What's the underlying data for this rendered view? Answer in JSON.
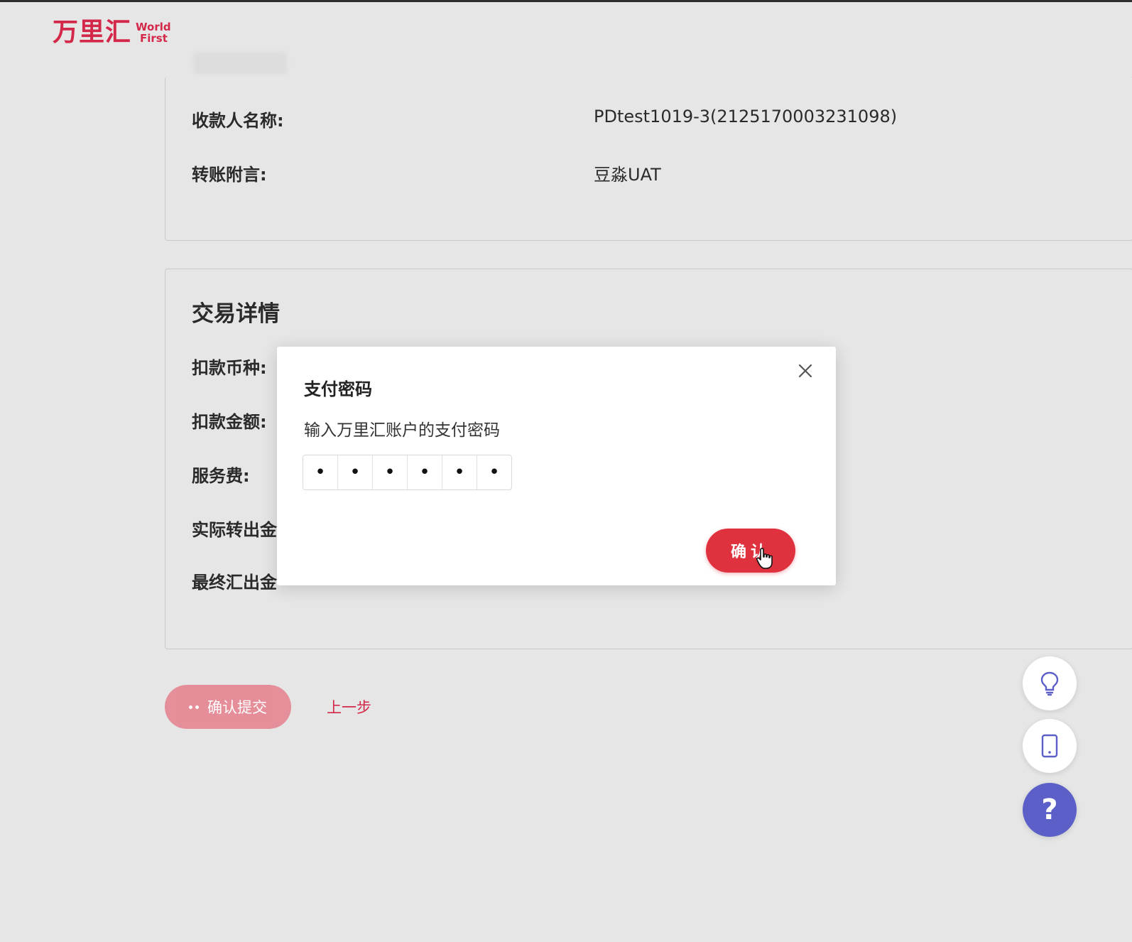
{
  "brand": {
    "name_cn": "万里汇",
    "name_en_line1": "World",
    "name_en_line2": "First",
    "color": "#d3284a"
  },
  "payee_card": {
    "rows": [
      {
        "label": "收款人名称:",
        "value": "PDtest1019-3(2125170003231098)"
      },
      {
        "label": "转账附言:",
        "value": "豆淼UAT"
      }
    ]
  },
  "transaction_card": {
    "title": "交易详情",
    "rows": [
      {
        "label": "扣款币种:"
      },
      {
        "label": "扣款金额:"
      },
      {
        "label": "服务费:"
      },
      {
        "label": "实际转出金"
      },
      {
        "label": "最终汇出金"
      }
    ]
  },
  "actions": {
    "submit_label": "确认提交",
    "back_label": "上一步"
  },
  "modal": {
    "title": "支付密码",
    "subtitle": "输入万里汇账户的支付密码",
    "pin": [
      "•",
      "•",
      "•",
      "•",
      "•",
      "•"
    ],
    "confirm_label": "确认",
    "accent": "#e0323e"
  },
  "floating_buttons": [
    {
      "icon": "lightbulb-icon"
    },
    {
      "icon": "mobile-icon"
    },
    {
      "icon": "help-icon",
      "label": "?"
    }
  ]
}
